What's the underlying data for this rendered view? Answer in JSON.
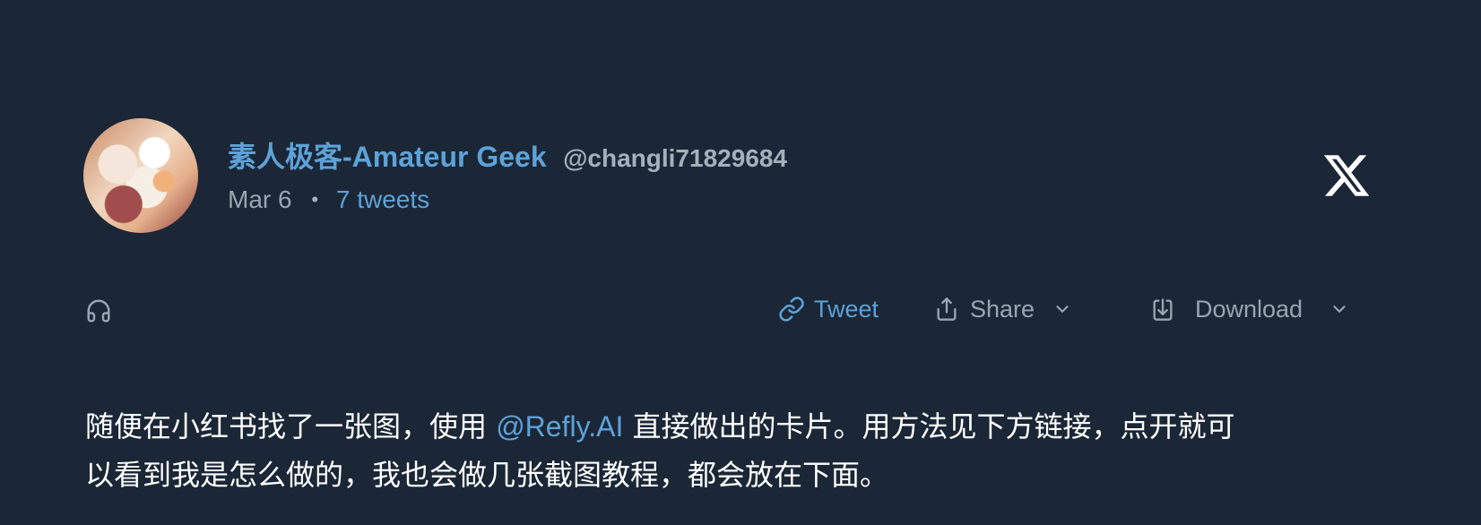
{
  "author": {
    "name": "素人极客-Amateur Geek",
    "handle": "@changli71829684",
    "date": "Mar 6",
    "separator": "•",
    "tweet_count": "7 tweets"
  },
  "actions": {
    "tweet_label": "Tweet",
    "share_label": "Share",
    "download_label": "Download"
  },
  "post": {
    "text_before": "随便在小红书找了一张图，使用 ",
    "mention": "@Refly.AI",
    "text_line1_after": " 直接做出的卡片。用方法见下方链接，点开就可",
    "text_line2": "以看到我是怎么做的，我也会做几张截图教程，都会放在下面。"
  },
  "icons": {
    "platform": "x-logo-icon",
    "audio": "headphones-icon",
    "link": "link-icon",
    "share": "share-icon",
    "download": "download-icon",
    "dropdown": "chevron-down-icon"
  },
  "colors": {
    "background": "#1b2736",
    "accent": "#5da2d8",
    "muted": "#9aa5b1",
    "text": "#ffffff"
  }
}
